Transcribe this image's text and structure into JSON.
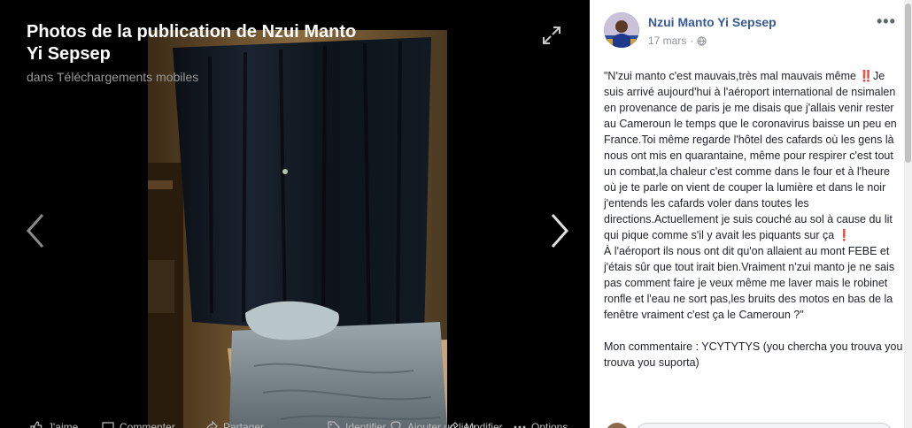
{
  "viewer": {
    "title": "Photos de la publication de Nzui Manto Yi Sepsep",
    "subtitle": "dans Téléchargements mobiles",
    "bottom_bar": [
      {
        "icon": "like-icon",
        "label": "J'aime"
      },
      {
        "icon": "comment-icon",
        "label": "Commenter"
      },
      {
        "icon": "share-icon",
        "label": "Partager"
      },
      {
        "icon": "tag-icon",
        "label": "Identifier"
      },
      {
        "icon": "location-icon",
        "label": "Ajouter un lieu"
      },
      {
        "icon": "edit-icon",
        "label": "Modifier"
      },
      {
        "icon": "options-icon",
        "label": "Options"
      }
    ]
  },
  "post": {
    "author": "Nzui Manto Yi Sepsep",
    "date": "17 mars",
    "separator": "·",
    "paragraphs": [
      "\"N'zui manto c'est mauvais,très mal mauvais même ‼️Je suis arrivé aujourd'hui à l'aéroport international de nsimalen en provenance de paris je me disais que j'allais venir rester au Cameroun le temps que le coronavirus baisse un peu en France.Toi même regarde l'hôtel des cafards où les gens là nous ont mis en quarantaine, même pour respirer c'est tout un combat,la chaleur c'est comme dans le four et à l'heure où je te parle on vient de couper la lumière et dans le noir j'entends les cafards voler dans toutes les directions.Actuellement je suis couché au sol à cause du lit qui pique comme s'il y avait les piquants sur ça ❗",
      "À l'aéroport ils nous ont dit qu'on allaient au mont FEBE et j'étais sûr que tout irait bien.Vraiment n'zui manto je ne sais pas comment faire je veux même me laver mais le robinet ronfle et l'eau ne sort pas,les bruits des motos en bas de la fenêtre vraiment c'est ça le Cameroun ?\"",
      "Mon commentaire : YCYTYTYS (you chercha you trouva you trouva you suporta)"
    ],
    "colors": {
      "author": "#385898",
      "text": "#1d2129",
      "meta": "#90949c"
    }
  }
}
